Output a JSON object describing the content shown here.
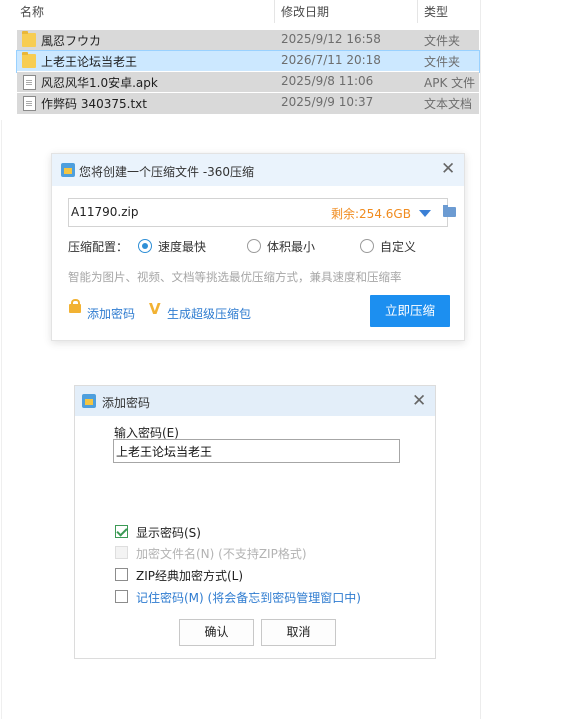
{
  "explorer": {
    "columns": {
      "name": "名称",
      "date": "修改日期",
      "type": "类型"
    },
    "rows": [
      {
        "name": "風忍フウカ",
        "date": "2025/9/12 16:58",
        "type": "文件夹",
        "icon": "folder-icon",
        "selected": false
      },
      {
        "name": "上老王论坛当老王",
        "date": "2026/7/11 20:18",
        "type": "文件夹",
        "icon": "folder-icon",
        "selected": true
      },
      {
        "name": "风忍风华1.0安卓.apk",
        "date": "2025/9/8 11:06",
        "type": "APK 文件",
        "icon": "file-icon",
        "selected": false
      },
      {
        "name": "作弊码   340375.txt",
        "date": "2025/9/9 10:37",
        "type": "文本文档",
        "icon": "file-icon",
        "selected": false
      }
    ]
  },
  "compress_dialog": {
    "title": "您将创建一个压缩文件 -360压缩",
    "filename": "A11790.zip",
    "remaining": "剩余:254.6GB",
    "config_label": "压缩配置：",
    "options": [
      {
        "label": "速度最快",
        "selected": true
      },
      {
        "label": "体积最小",
        "selected": false
      },
      {
        "label": "自定义",
        "selected": false
      }
    ],
    "hint": "智能为图片、视频、文档等挑选最优压缩方式，兼具速度和压缩率",
    "add_password": "添加密码",
    "super_pack": "生成超级压缩包",
    "compress_button": "立即压缩",
    "colors": {
      "accent": "#1c8ff0",
      "remaining": "#f08b1e"
    }
  },
  "password_dialog": {
    "title": "添加密码",
    "input_label": "输入密码(E)",
    "password_value": "上老王论坛当老王",
    "checkboxes": [
      {
        "label": "显示密码(S)",
        "checked": true,
        "disabled": false
      },
      {
        "label": "加密文件名(N) (不支持ZIP格式)",
        "checked": false,
        "disabled": true
      },
      {
        "label": "ZIP经典加密方式(L)",
        "checked": false,
        "disabled": false
      },
      {
        "label": "记住密码(M) (将会备忘到密码管理窗口中)",
        "checked": false,
        "disabled": false
      }
    ],
    "ok_button": "确认",
    "cancel_button": "取消"
  }
}
